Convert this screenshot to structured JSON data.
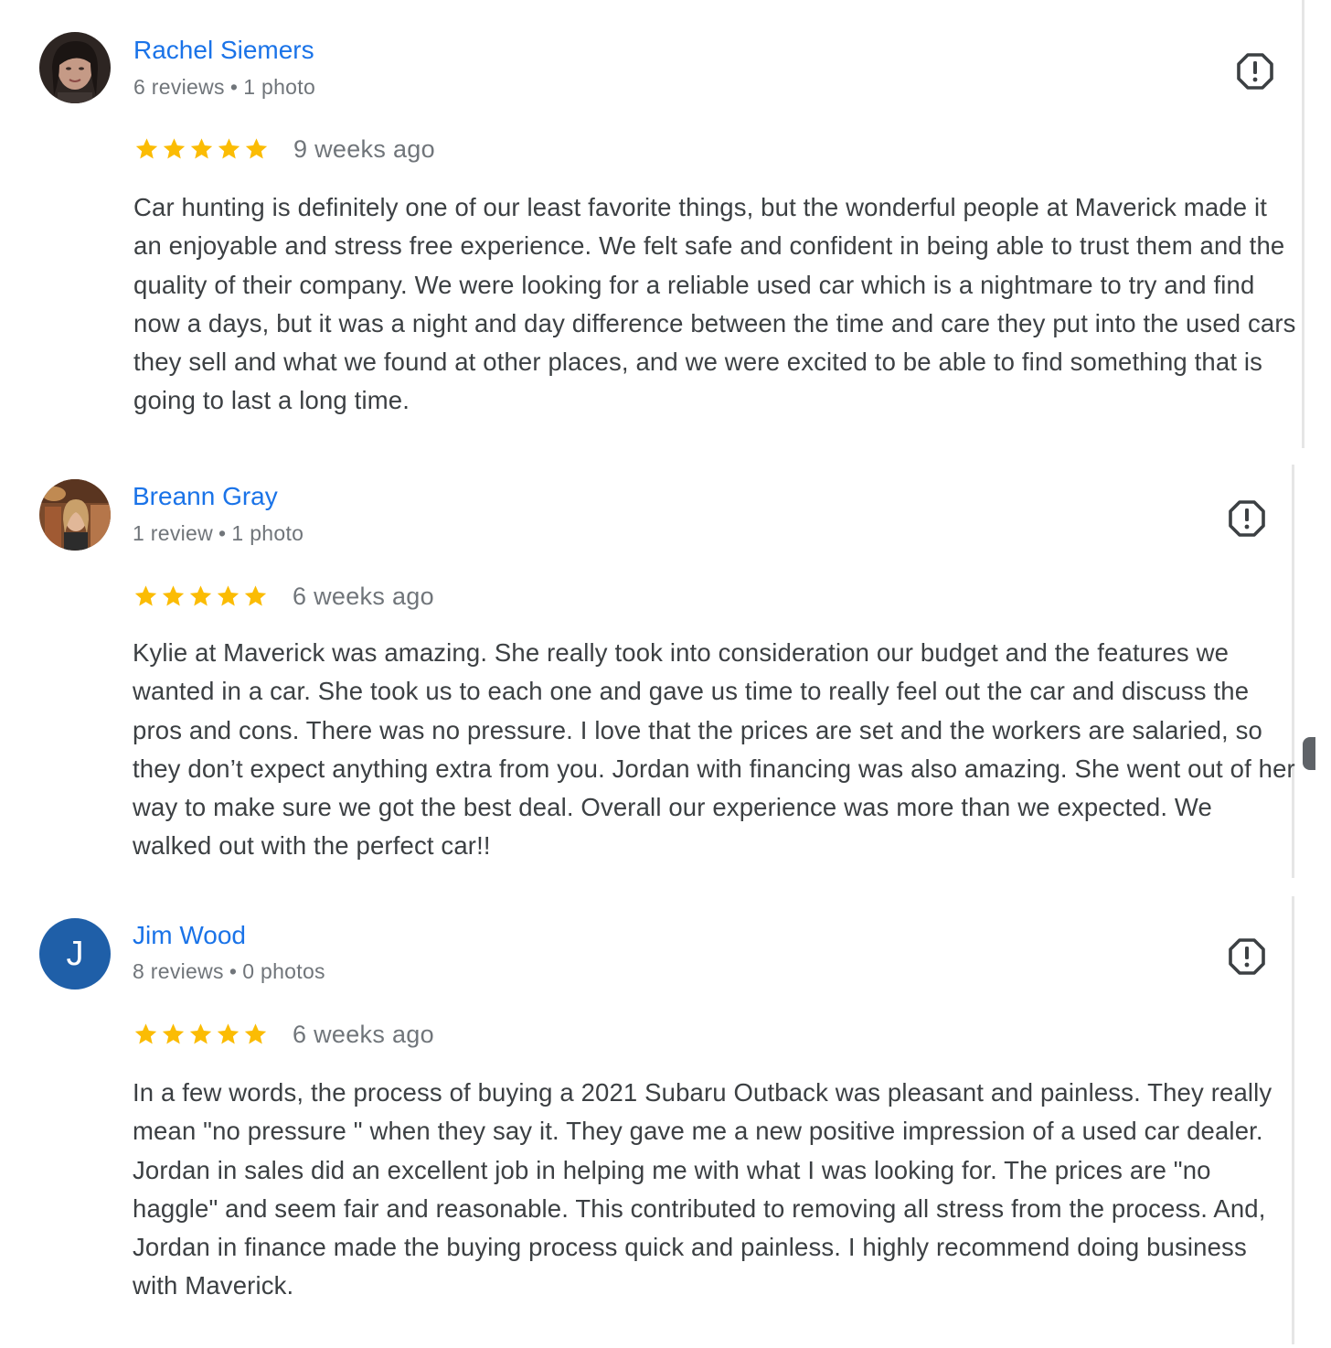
{
  "reviews": [
    {
      "name": "Rachel Siemers",
      "review_count": "6 reviews",
      "photo_count": "1 photo",
      "separator": "•",
      "rating": 5,
      "date": "9 weeks ago",
      "avatar_type": "photo",
      "text": "Car hunting is definitely one of our least favorite things, but the wonderful people at Maverick made it an enjoyable and stress free experience. We felt safe and confident in being able to trust them and the quality of their company. We were looking for a reliable used car which is a nightmare to try and find now a days, but it was a night and day difference between the time and care they put into the used cars they sell and what we found at other places, and we were excited to be able to find something that is going to last a long time."
    },
    {
      "name": "Breann Gray",
      "review_count": "1 review",
      "photo_count": "1 photo",
      "separator": "•",
      "rating": 5,
      "date": "6 weeks ago",
      "avatar_type": "photo",
      "text": "Kylie at Maverick was amazing. She really took into consideration our budget and the features we wanted in a car. She took us to each one and gave us time to really feel out the car and discuss the pros and cons. There was no pressure. I love that the prices are set and the workers are salaried, so they don’t expect anything extra from you. Jordan with financing was also amazing. She went out of her way to make sure we got the best deal. Overall our experience was more than we expected. We walked out with the perfect car!!"
    },
    {
      "name": "Jim Wood",
      "review_count": "8 reviews",
      "photo_count": "0 photos",
      "separator": "•",
      "rating": 5,
      "date": "6 weeks ago",
      "avatar_type": "letter",
      "avatar_letter": "J",
      "text": "In a few words, the process of buying a 2021 Subaru Outback was pleasant and painless. They really mean \"no pressure \" when they say it. They gave me a new positive impression of a used car dealer. Jordan in sales did an excellent job in helping me with what I was looking for. The prices are \"no haggle\" and seem fair and reasonable. This contributed to removing all stress from the process. And, Jordan in finance made the buying process quick and painless. I highly recommend doing business with Maverick."
    }
  ],
  "icons": {
    "flag": "report-flag-icon",
    "star": "star-icon"
  },
  "colors": {
    "name_link": "#1a73e8",
    "star": "#fbbc04",
    "meta_text": "#70757a",
    "body_text": "#3c4043",
    "letter_avatar_bg": "#1f5fa8"
  }
}
